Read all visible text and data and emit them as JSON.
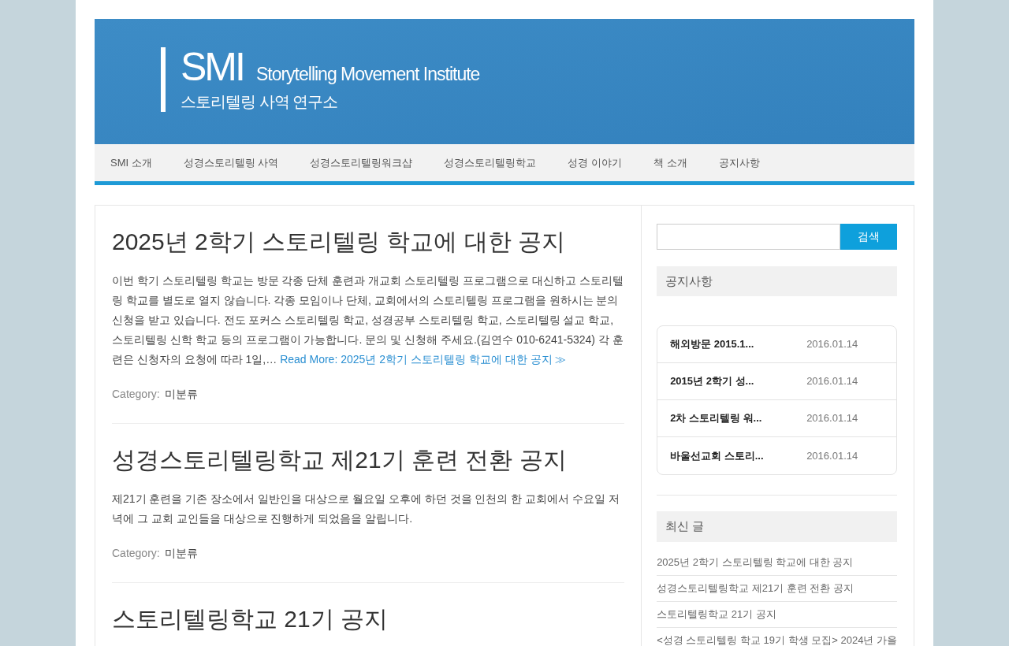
{
  "header": {
    "logo": "SMI",
    "tagline": "Storytelling Movement Institute",
    "subtitle": "스토리텔링 사역 연구소"
  },
  "nav": [
    "SMI 소개",
    "성경스토리텔링 사역",
    "성경스토리텔링워크샵",
    "성경스토리텔링학교",
    "성경 이야기",
    "책 소개",
    "공지사항"
  ],
  "posts": [
    {
      "title": "2025년 2학기 스토리텔링 학교에 대한 공지",
      "excerpt": "이번 학기 스토리텔링 학교는 방문 각종 단체 훈련과 개교회 스토리텔링 프로그램으로 대신하고 스토리텔링 학교를 별도로 열지 않습니다. 각종 모임이나 단체, 교회에서의 스토리텔링 프로그램을 원하시는 분의 신청을 받고 있습니다. 전도 포커스 스토리텔링 학교, 성경공부 스토리텔링 학교, 스토리텔링 설교 학교, 스토리텔링 신학 학교 등의 프로그램이 가능합니다. 문의 및 신청해 주세요.(김연수 010-6241-5324) 각 훈련은 신청자의 요청에 따라 1일,…",
      "read_more": "Read More: 2025년 2학기 스토리텔링 학교에 대한 공지 ≫",
      "category_label": "Category:",
      "category": "미분류"
    },
    {
      "title": "성경스토리텔링학교 제21기 훈련 전환 공지",
      "excerpt": "제21기 훈련을 기존 장소에서 일반인을 대상으로 월요일 오후에 하던 것을 인천의 한 교회에서 수요일 저녁에 그 교회 교인들을 대상으로 진행하게 되었음을 알립니다.",
      "category_label": "Category:",
      "category": "미분류"
    },
    {
      "title": "스토리텔링학교 21기 공지"
    }
  ],
  "sidebar": {
    "search": {
      "button": "검색"
    },
    "notices": {
      "title": "공지사항",
      "items": [
        {
          "title": "해외방문 2015.1...",
          "date": "2016.01.14"
        },
        {
          "title": "2015년 2학기 성...",
          "date": "2016.01.14"
        },
        {
          "title": "2차 스토리텔링 워...",
          "date": "2016.01.14"
        },
        {
          "title": "바울선교회 스토리...",
          "date": "2016.01.14"
        }
      ]
    },
    "recent_posts": {
      "title": "최신 글",
      "items": [
        "2025년 2학기 스토리텔링 학교에 대한 공지",
        "성경스토리텔링학교 제21기 훈련 전환 공지",
        "스토리텔링학교 21기 공지",
        "<성경 스토리텔링 학교 19기 학생 모집> 2024년 가을"
      ]
    }
  }
}
